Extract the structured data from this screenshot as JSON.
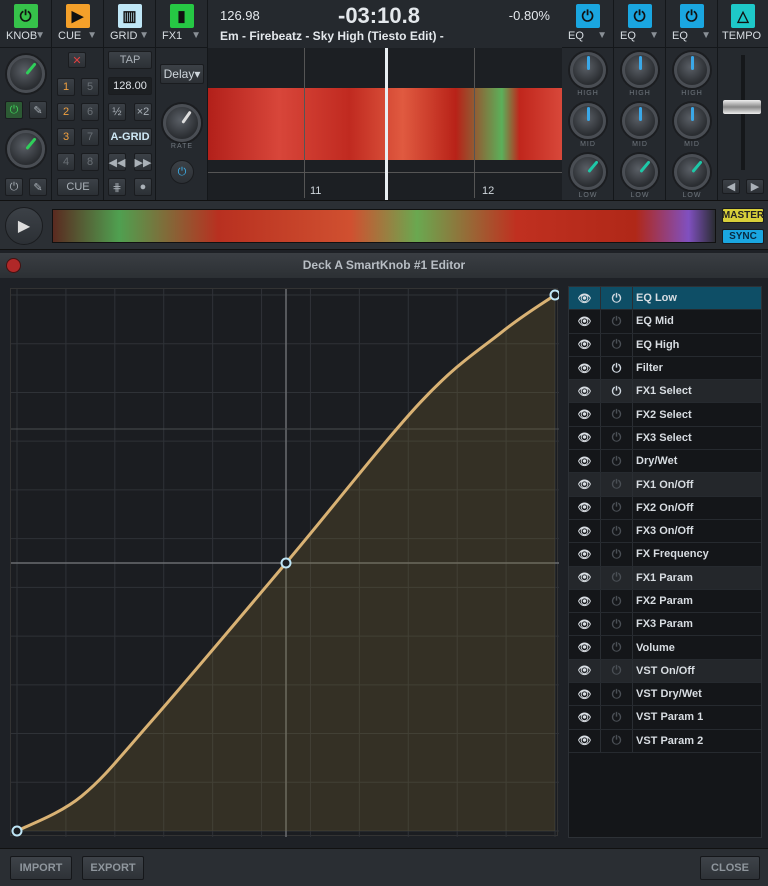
{
  "deck": {
    "sections": [
      {
        "label": "KNOB",
        "icon": "power-icon",
        "color": "#36c24a"
      },
      {
        "label": "CUE",
        "icon": "play-cue-icon",
        "color": "#f4a02a"
      },
      {
        "label": "GRID",
        "icon": "piano-grid-icon",
        "color": "#bfe6f6"
      },
      {
        "label": "FX1",
        "icon": "equalizer-bars-icon",
        "color": "#26c844"
      }
    ],
    "bpm": "126.98",
    "time": "-03:10.8",
    "pitch": "-0.80%",
    "track": "Em - Firebeatz - Sky High (Tiesto Edit) -",
    "cue_buttons": [
      "1",
      "5",
      "2",
      "6",
      "3",
      "7",
      "4",
      "8"
    ],
    "cue_label": "CUE",
    "tap_label": "TAP",
    "grid_bpm": "128.00",
    "half_label": "½",
    "double_label": "×2",
    "agrid_label": "A-GRID",
    "fx_select": "Delay",
    "rate_label": "RATE",
    "beat_markers": [
      "11",
      "12"
    ],
    "eq_sections": [
      {
        "label": "EQ"
      },
      {
        "label": "EQ"
      },
      {
        "label": "EQ"
      }
    ],
    "eq_knob_labels": [
      "HIGH",
      "MID",
      "LOW"
    ],
    "tempo_label": "TEMPO",
    "master_label": "MASTER",
    "sync_label": "SYNC",
    "accent": "#1aa6d8"
  },
  "editor": {
    "title": "Deck A SmartKnob #1 Editor",
    "curve_color": "#d9b274",
    "curve_points": [
      [
        0,
        0
      ],
      [
        0.12,
        0.065
      ],
      [
        0.25,
        0.205
      ],
      [
        0.5,
        0.5
      ],
      [
        0.75,
        0.8
      ],
      [
        0.9,
        0.93
      ],
      [
        1,
        1
      ]
    ],
    "parameters": [
      {
        "label": "EQ Low",
        "active": true,
        "selected": true
      },
      {
        "label": "EQ Mid",
        "active": false
      },
      {
        "label": "EQ High",
        "active": false
      },
      {
        "label": "Filter",
        "active": true
      },
      {
        "label": "FX1 Select",
        "active": true,
        "group": true
      },
      {
        "label": "FX2 Select",
        "active": false
      },
      {
        "label": "FX3 Select",
        "active": false
      },
      {
        "label": "Dry/Wet",
        "active": false
      },
      {
        "label": "FX1 On/Off",
        "active": false,
        "group": true
      },
      {
        "label": "FX2 On/Off",
        "active": false
      },
      {
        "label": "FX3 On/Off",
        "active": false
      },
      {
        "label": "FX Frequency",
        "active": false
      },
      {
        "label": "FX1 Param",
        "active": false,
        "group": true
      },
      {
        "label": "FX2 Param",
        "active": false
      },
      {
        "label": "FX3 Param",
        "active": false
      },
      {
        "label": "Volume",
        "active": false
      },
      {
        "label": "VST On/Off",
        "active": false,
        "group": true
      },
      {
        "label": "VST Dry/Wet",
        "active": false
      },
      {
        "label": "VST Param 1",
        "active": false
      },
      {
        "label": "VST Param 2",
        "active": false
      }
    ],
    "import_label": "IMPORT",
    "export_label": "EXPORT",
    "close_label": "CLOSE"
  }
}
